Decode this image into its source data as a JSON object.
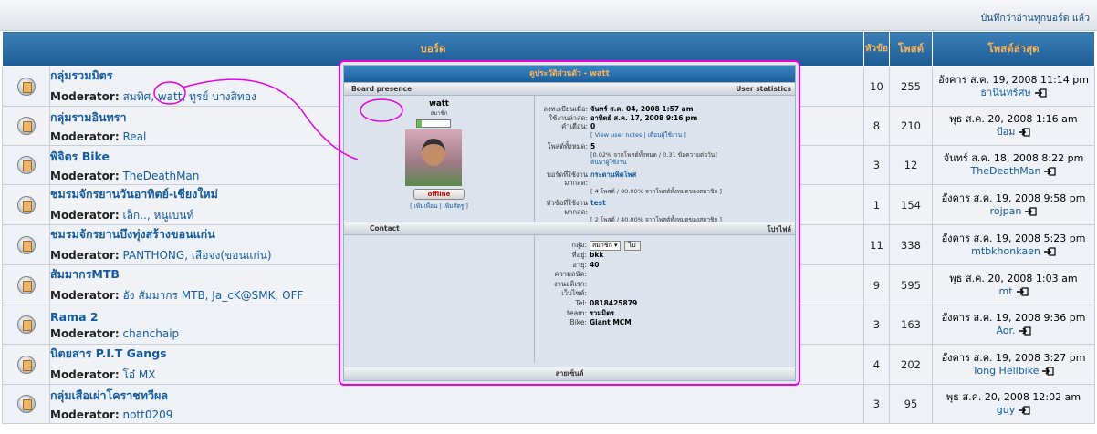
{
  "header": {
    "mark_read": "บันทึกว่าอ่านทุกบอร์ด แล้ว"
  },
  "columns": {
    "board": "บอร์ด",
    "topics": "หัวข้อ",
    "posts": "โพสต์",
    "last_post": "โพสต์ล่าสุด"
  },
  "moderator_label": "Moderator:",
  "forums": [
    {
      "name": "กลุ่มรวมมิตร",
      "mods": "สมทิศ, watt, ทูรย์ บางสิทอง",
      "topics": "10",
      "posts": "255",
      "last_date": "อังคาร ส.ค. 19, 2008 11:14 pm",
      "last_user": "ธานินทร์ศษ"
    },
    {
      "name": "กลุ่มรามอินทรา",
      "mods": "Real",
      "topics": "8",
      "posts": "210",
      "last_date": "พุธ ส.ค. 20, 2008 1:16 am",
      "last_user": "ป้อม"
    },
    {
      "name": "พิจิตร Bike",
      "mods": "TheDeathMan",
      "topics": "3",
      "posts": "12",
      "last_date": "จันทร์ ส.ค. 18, 2008 8:22 pm",
      "last_user": "TheDeathMan"
    },
    {
      "name": "ชมรมจักรยานวันอาทิตย์-เชียงใหม่",
      "mods": "เล็ก.., หนูเบนท์",
      "topics": "1",
      "posts": "154",
      "last_date": "อังคาร ส.ค. 19, 2008 9:58 pm",
      "last_user": "rojpan"
    },
    {
      "name": "ชมรมจักรยานบึงทุ่งสร้างขอนแก่น",
      "mods": "PANTHONG, เสือจง(ขอนแก่น)",
      "topics": "11",
      "posts": "338",
      "last_date": "อังคาร ส.ค. 19, 2008 5:23 pm",
      "last_user": "mtbkhonkaen"
    },
    {
      "name": "สัมมากรMTB",
      "mods": "อัง สัมมากร MTB, Ja_cK@SMK, OFF",
      "topics": "9",
      "posts": "595",
      "last_date": "พุธ ส.ค. 20, 2008 1:03 am",
      "last_user": "mt"
    },
    {
      "name": "Rama 2",
      "mods": "chanchaip",
      "topics": "3",
      "posts": "163",
      "last_date": "อังคาร ส.ค. 19, 2008 9:36 pm",
      "last_user": "Aor."
    },
    {
      "name": "นิตยสาร P.I.T Gangs",
      "mods": "โอ๋ MX",
      "topics": "4",
      "posts": "202",
      "last_date": "อังคาร ส.ค. 19, 2008 3:27 pm",
      "last_user": "Tong Hellbike"
    },
    {
      "name": "กลุ่มเสือเผ่าโคราชทวีผล",
      "mods": "nott0209",
      "topics": "3",
      "posts": "95",
      "last_date": "พุธ ส.ค. 20, 2008 12:02 am",
      "last_user": "guy"
    }
  ],
  "popup": {
    "title": "ดูประวัติส่วนตัว - watt",
    "board_presence": "Board presence",
    "user_statistics": "User statistics",
    "username": "watt",
    "rank": "สมาชิก",
    "status": "offline",
    "left_links": "[ เพิ่มเพื่อน | เพิ่มศัตรู ]",
    "stats": {
      "joined_k": "ลงทะเบียนเมื่อ:",
      "joined_v": "จันทร์ ส.ค. 04, 2008 1:57 am",
      "lastvisit_k": "ใช้งานล่าสุด:",
      "lastvisit_v": "อาทิตย์ ส.ค. 17, 2008 9:16 pm",
      "warn_k": "คำเตือน:",
      "warn_v": "0",
      "warn_links": "[ View user notes | เตือนผู้ใช้งาน ]",
      "posts_k": "โพสต์ทั้งหมด:",
      "posts_v": "5",
      "posts_sub": "[0.02% จากโพสต์ทั้งหมด / 0.31 ข้อความต่อวัน]",
      "posts_link": "ค้นหาผู้ใช้งาน",
      "board_k": "บอร์ดที่ใช้งานมากสุด:",
      "board_v": "กระดานพิดโพส",
      "board_sub": "[ 4 โพสต์ / 80.00% จากโพสต์ทั้งหมดของสมาชิก ]",
      "topic_k": "หัวข้อที่ใช้งานมากสุด:",
      "topic_v": "test",
      "topic_sub": "[ 2 โพสต์ / 40.00% จากโพสต์ทั้งหมดของสมาชิก ]"
    },
    "contact": "Contact",
    "profile": "โปรไฟล์",
    "group_k": "กลุ่ม:",
    "group_sel": "สมาชิก",
    "group_go": "ไป",
    "profile_rows": [
      {
        "k": "ที่อยู่:",
        "v": "bkk"
      },
      {
        "k": "อายุ:",
        "v": "40"
      },
      {
        "k": "ความถนัด:",
        "v": ""
      },
      {
        "k": "งานอดิเรก:",
        "v": ""
      },
      {
        "k": "เว็บไซต์:",
        "v": ""
      },
      {
        "k": "Tel:",
        "v": "0818425879"
      },
      {
        "k": "team:",
        "v": "รวมมิตร"
      },
      {
        "k": "Bike:",
        "v": "Giant MCM"
      }
    ],
    "signature": "ลายเซ็นต์"
  }
}
